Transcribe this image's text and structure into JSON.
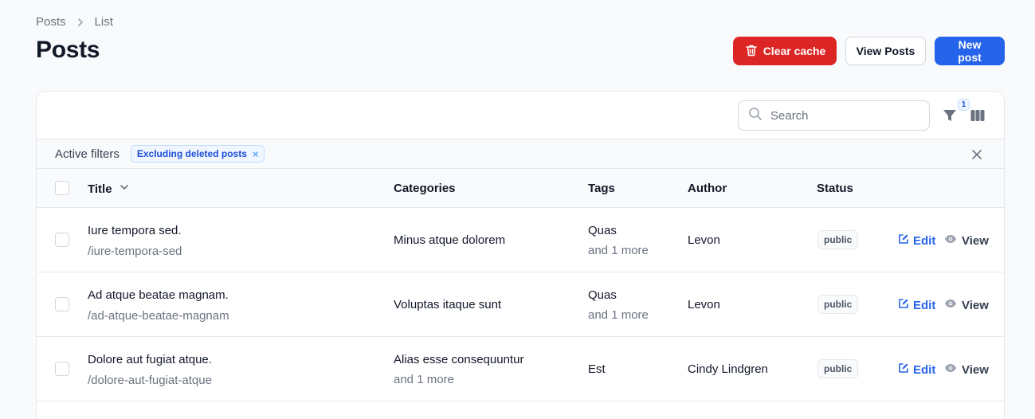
{
  "breadcrumb": {
    "items": [
      "Posts",
      "List"
    ]
  },
  "page_title": "Posts",
  "header_actions": {
    "clear_cache": "Clear cache",
    "view_posts": "View Posts",
    "new_post": "New post"
  },
  "toolbar": {
    "search_placeholder": "Search",
    "filter_count": "1"
  },
  "active_filters": {
    "label": "Active filters",
    "chips": [
      "Excluding deleted posts"
    ],
    "chip_remove": "×"
  },
  "table": {
    "columns": [
      "Title",
      "Categories",
      "Tags",
      "Author",
      "Status"
    ],
    "actions": {
      "edit": "Edit",
      "view": "View"
    },
    "rows": [
      {
        "title": "Iure tempora sed.",
        "slug": "/iure-tempora-sed",
        "category": "Minus atque dolorem",
        "category_more": "",
        "tag": "Quas",
        "tag_more": "and 1 more",
        "author": "Levon",
        "status": "public"
      },
      {
        "title": "Ad atque beatae magnam.",
        "slug": "/ad-atque-beatae-magnam",
        "category": "Voluptas itaque sunt",
        "category_more": "",
        "tag": "Quas",
        "tag_more": "and 1 more",
        "author": "Levon",
        "status": "public"
      },
      {
        "title": "Dolore aut fugiat atque.",
        "slug": "/dolore-aut-fugiat-atque",
        "category": "Alias esse consequuntur",
        "category_more": "and 1 more",
        "tag": "Est",
        "tag_more": "",
        "author": "Cindy Lindgren",
        "status": "public"
      }
    ]
  },
  "colors": {
    "danger": "#dc2626",
    "primary": "#2563eb",
    "background": "#f9fafb"
  },
  "icons": [
    "chevron-right-icon",
    "trash-icon",
    "search-icon",
    "filter-icon",
    "columns-icon",
    "close-icon",
    "chevron-down-icon",
    "edit-icon",
    "eye-icon"
  ]
}
